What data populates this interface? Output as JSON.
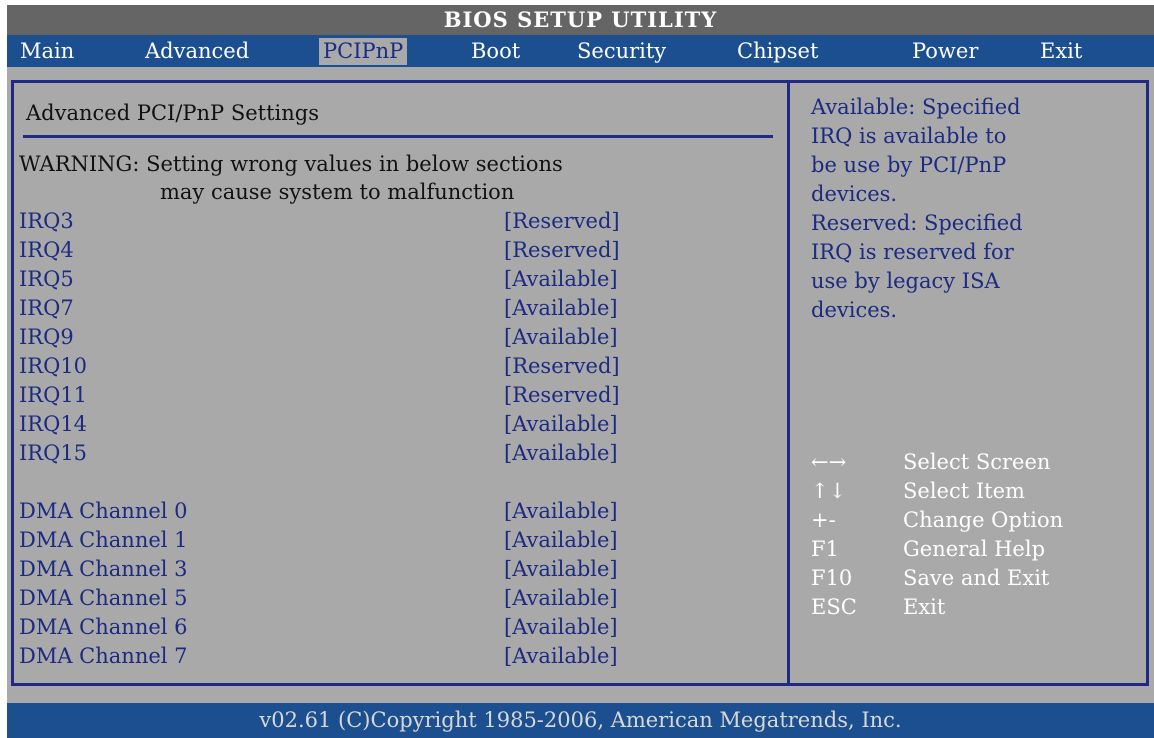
{
  "title": "BIOS SETUP UTILITY",
  "menu": {
    "items": [
      "Main",
      "Advanced",
      "PCIPnP",
      "Boot",
      "Security",
      "Chipset",
      "Power",
      "Exit"
    ],
    "active": "PCIPnP"
  },
  "section": {
    "title": "Advanced PCI/PnP Settings",
    "warning_line1": "WARNING: Setting wrong values in below sections",
    "warning_line2": "may cause system to malfunction"
  },
  "settings": [
    {
      "label": "IRQ3",
      "value": "[Reserved]"
    },
    {
      "label": "IRQ4",
      "value": "[Reserved]"
    },
    {
      "label": "IRQ5",
      "value": "[Available]"
    },
    {
      "label": "IRQ7",
      "value": "[Available]"
    },
    {
      "label": "IRQ9",
      "value": "[Available]"
    },
    {
      "label": "IRQ10",
      "value": "[Reserved]"
    },
    {
      "label": "IRQ11",
      "value": "[Reserved]"
    },
    {
      "label": "IRQ14",
      "value": "[Available]"
    },
    {
      "label": "IRQ15",
      "value": "[Available]"
    },
    {
      "label": "DMA Channel 0",
      "value": "[Available]"
    },
    {
      "label": "DMA Channel 1",
      "value": "[Available]"
    },
    {
      "label": "DMA Channel 3",
      "value": "[Available]"
    },
    {
      "label": "DMA Channel 5",
      "value": "[Available]"
    },
    {
      "label": "DMA Channel 6",
      "value": "[Available]"
    },
    {
      "label": "DMA Channel 7",
      "value": "[Available]"
    }
  ],
  "help": {
    "lines": [
      "Available: Specified",
      "IRQ is available to",
      "be use by PCI/PnP",
      "devices.",
      "Reserved: Specified",
      "IRQ is reserved for",
      "use by legacy ISA",
      "devices."
    ]
  },
  "keys": [
    {
      "key": "←→",
      "desc": "Select Screen"
    },
    {
      "key": "↑↓",
      "desc": "Select Item"
    },
    {
      "key": "+-",
      "desc": "Change Option"
    },
    {
      "key": "F1",
      "desc": "General Help"
    },
    {
      "key": "F10",
      "desc": "Save and Exit"
    },
    {
      "key": "ESC",
      "desc": "Exit"
    }
  ],
  "footer": "v02.61 (C)Copyright 1985-2006, American Megatrends, Inc.",
  "colors": {
    "menu_bar": "#1b4f8f",
    "title_bar": "#656565",
    "panel_bg": "#a9a9a9",
    "item_text": "#1c2a82",
    "key_text": "#ffffff"
  }
}
